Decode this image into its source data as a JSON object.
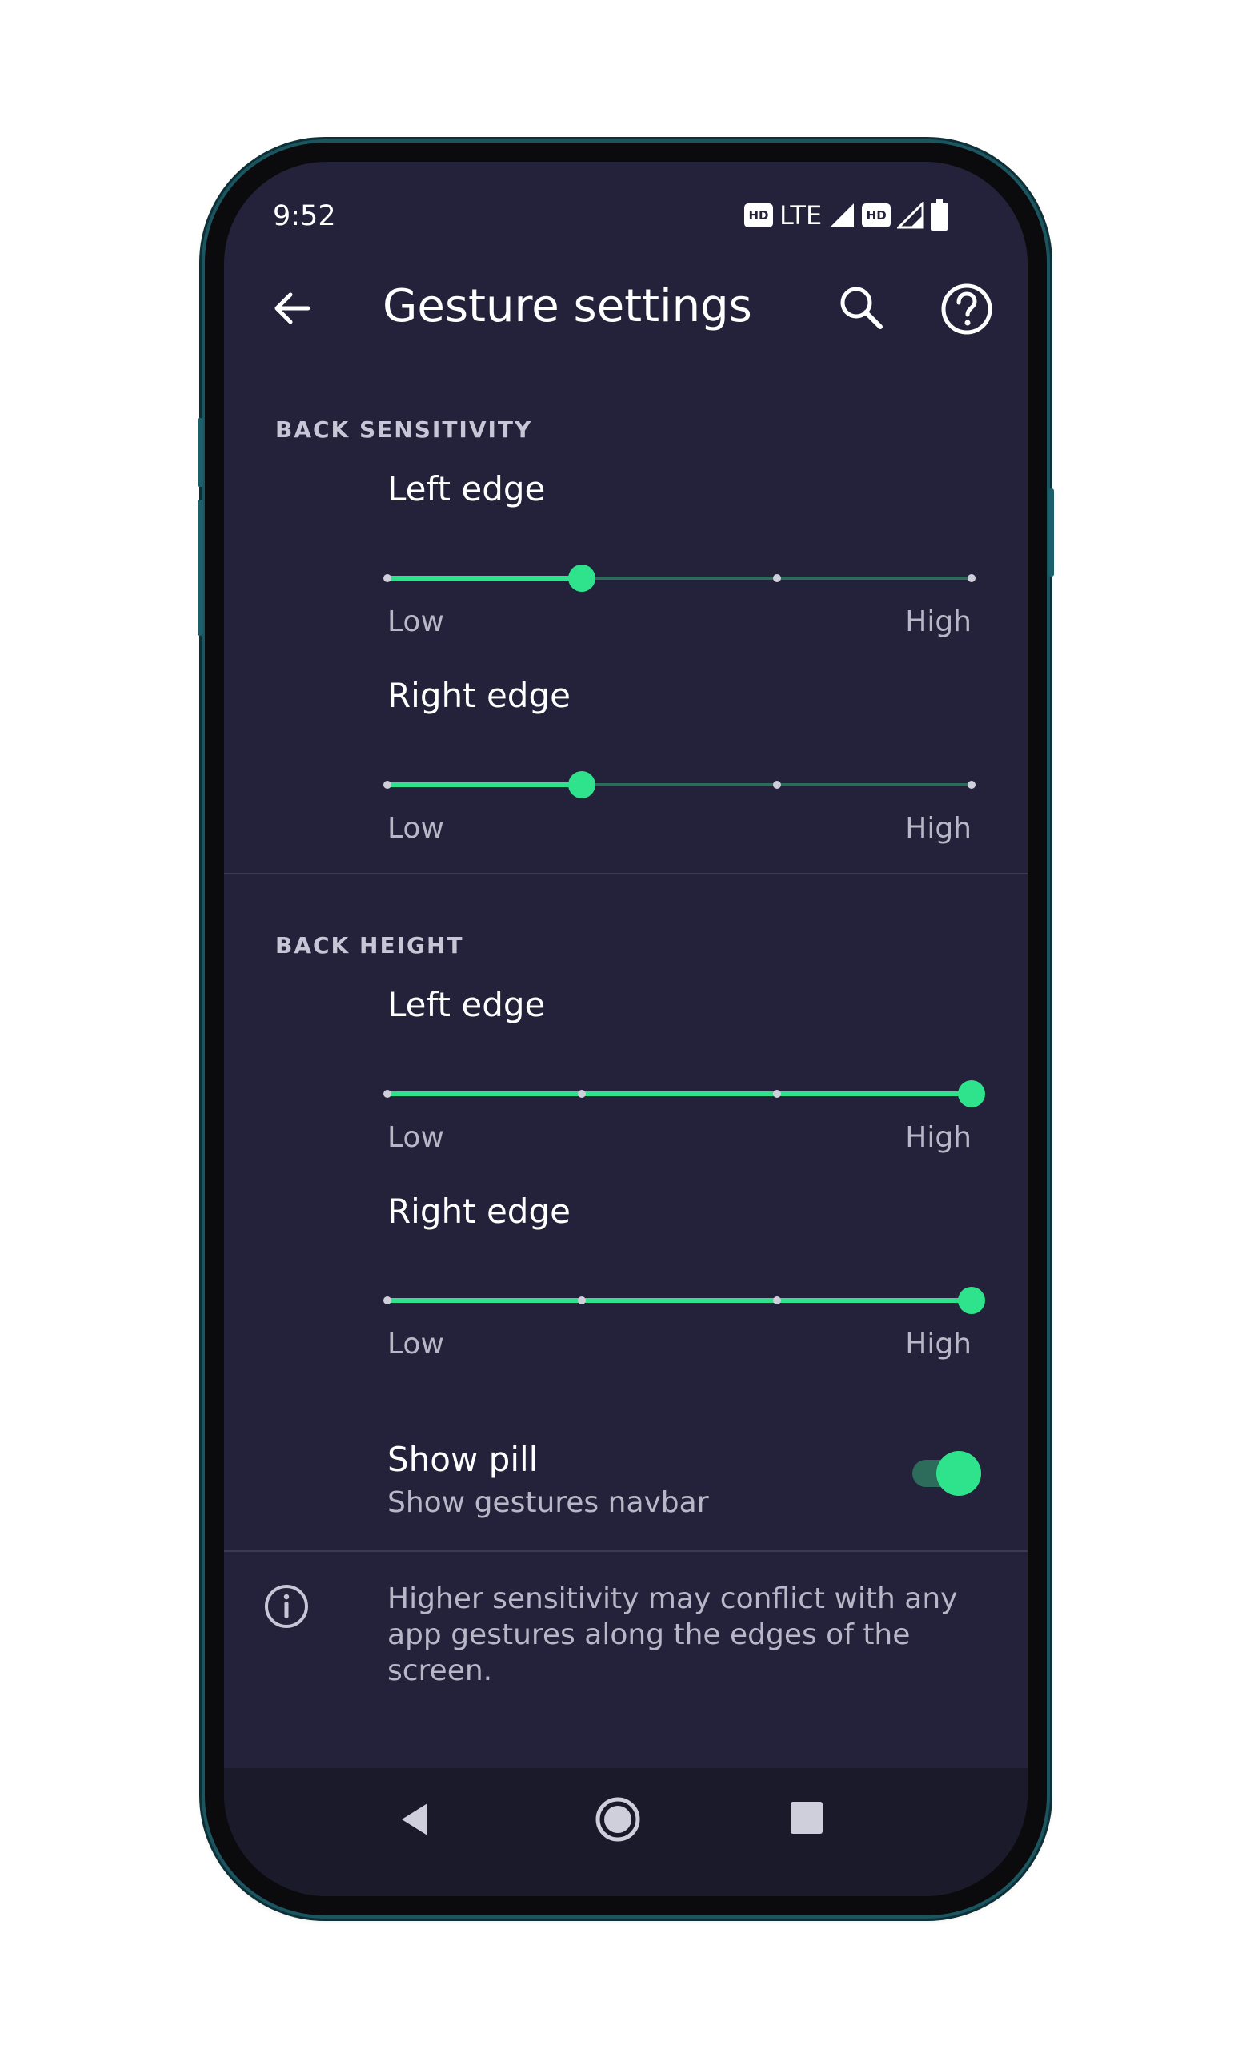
{
  "status_bar": {
    "time": "9:52",
    "network_label": "LTE",
    "hd_badge": "HD",
    "icons": [
      "hd-icon",
      "signal-icon",
      "hd-icon",
      "signal-icon",
      "battery-icon"
    ]
  },
  "app_bar": {
    "title": "Gesture settings",
    "icons": [
      "back-arrow-icon",
      "search-icon",
      "help-icon"
    ]
  },
  "back_sensitivity": {
    "header": "BACK SENSITIVITY",
    "left": {
      "label": "Left edge",
      "low": "Low",
      "high": "High",
      "level_index": 1,
      "steps": 4
    },
    "right": {
      "label": "Right edge",
      "low": "Low",
      "high": "High",
      "level_index": 1,
      "steps": 4
    }
  },
  "back_height": {
    "header": "BACK HEIGHT",
    "left": {
      "label": "Left edge",
      "low": "Low",
      "high": "High",
      "level_index": 3,
      "steps": 4
    },
    "right": {
      "label": "Right edge",
      "low": "Low",
      "high": "High",
      "level_index": 3,
      "steps": 4
    }
  },
  "show_pill": {
    "title": "Show pill",
    "subtitle": "Show gestures navbar",
    "enabled": true
  },
  "info": {
    "icon": "info-icon",
    "text": "Higher sensitivity may conflict with any app gestures along the edges of the screen."
  },
  "nav_bar": {
    "icons": [
      "nav-back-icon",
      "nav-home-icon",
      "nav-recents-icon"
    ]
  },
  "colors": {
    "background": "#23223a",
    "accent": "#2ee38c",
    "track_inactive": "#2f6b5a",
    "text_primary": "#ffffff",
    "text_secondary": "#b8b7c7"
  }
}
